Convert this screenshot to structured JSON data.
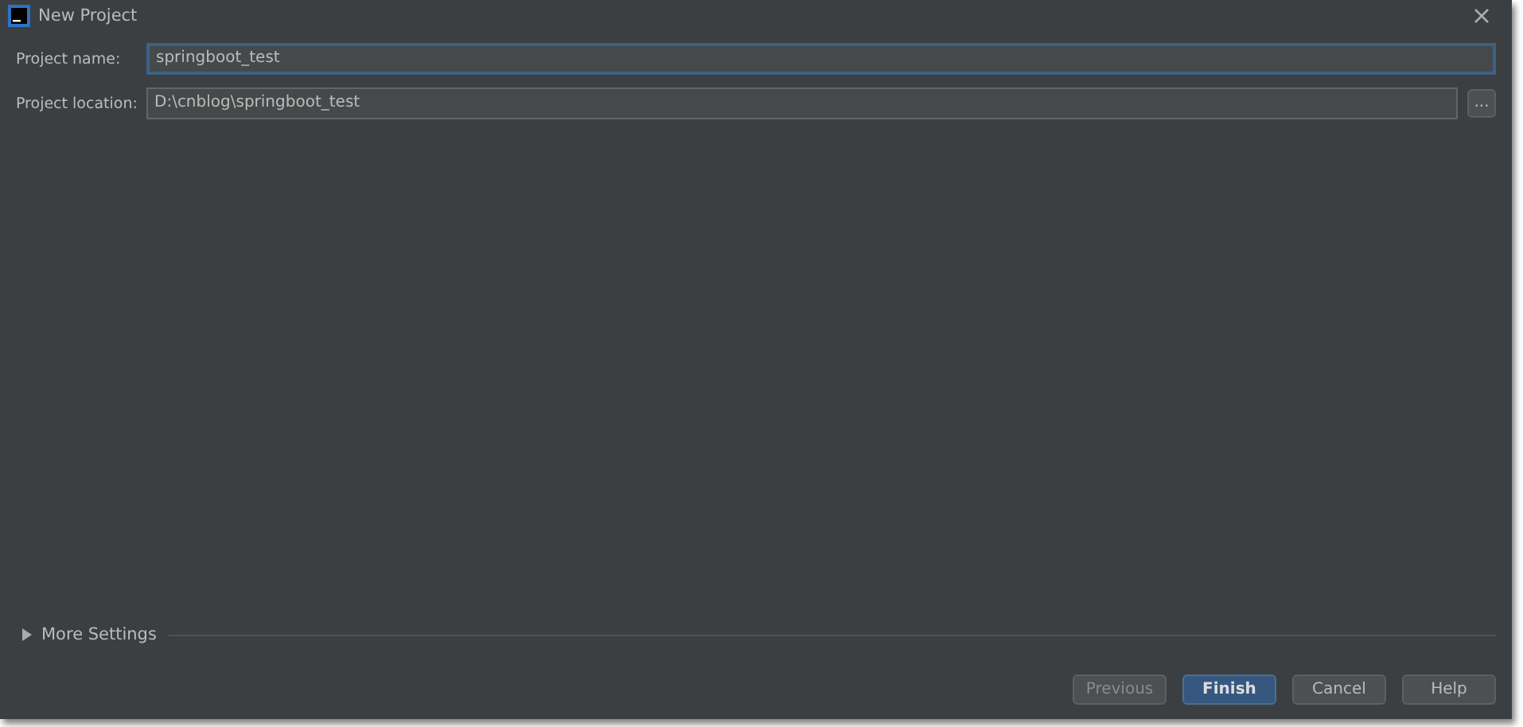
{
  "window": {
    "title": "New Project"
  },
  "fields": [
    {
      "label": "Project name:",
      "value": "springboot_test",
      "focused": true
    },
    {
      "label": "Project location:",
      "value": "D:\\cnblog\\springboot_test",
      "focused": false,
      "browse": "..."
    }
  ],
  "more_settings": {
    "label": "More Settings",
    "expanded": false
  },
  "buttons": [
    {
      "label": "Previous",
      "disabled": true,
      "default": false
    },
    {
      "label": "Finish",
      "disabled": false,
      "default": true
    },
    {
      "label": "Cancel",
      "disabled": false,
      "default": false
    },
    {
      "label": "Help",
      "disabled": false,
      "default": false
    }
  ]
}
